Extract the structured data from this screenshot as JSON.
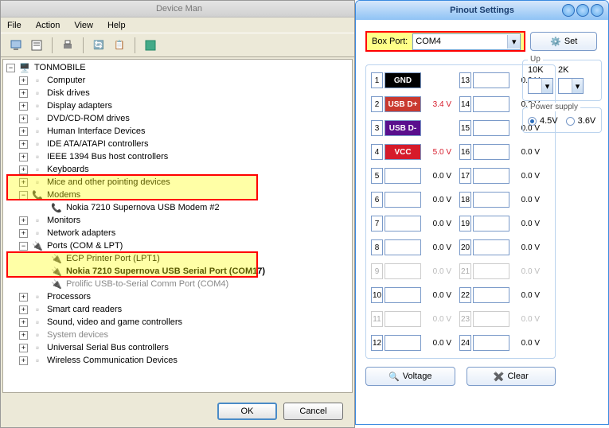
{
  "dm": {
    "title": "Device Man",
    "menu": [
      "File",
      "Action",
      "View",
      "Help"
    ],
    "root": "TONMOBILE",
    "items": [
      {
        "label": "Computer"
      },
      {
        "label": "Disk drives"
      },
      {
        "label": "Display adapters"
      },
      {
        "label": "DVD/CD-ROM drives"
      },
      {
        "label": "Human Interface Devices"
      },
      {
        "label": "IDE ATA/ATAPI controllers"
      },
      {
        "label": "IEEE 1394 Bus host controllers"
      },
      {
        "label": "Keyboards"
      },
      {
        "label": "Mice and other pointing devices"
      }
    ],
    "modems_label": "Modems",
    "modem_child": "Nokia 7210 Supernova USB Modem #2",
    "items2": [
      {
        "label": "Monitors"
      },
      {
        "label": "Network adapters"
      }
    ],
    "ports_label": "Ports (COM & LPT)",
    "port_ecp": "ECP Printer Port (LPT1)",
    "port_nokia": "Nokia 7210 Supernova USB Serial Port (COM17)",
    "port_prolific": "Prolific USB-to-Serial Comm Port (COM4)",
    "items3": [
      {
        "label": "Processors"
      },
      {
        "label": "Smart card readers"
      },
      {
        "label": "Sound, video and game controllers"
      },
      {
        "label": "System devices",
        "gray": true
      },
      {
        "label": "Universal Serial Bus controllers"
      },
      {
        "label": "Wireless Communication Devices"
      }
    ],
    "ok": "OK",
    "cancel": "Cancel"
  },
  "ps": {
    "title": "Pinout Settings",
    "box_port_label": "Box Port:",
    "box_port_value": "COM4",
    "set": "Set",
    "pins_left": [
      {
        "n": "1",
        "tag": "GND",
        "tagcls": "gnd",
        "val": ""
      },
      {
        "n": "2",
        "tag": "USB D+",
        "tagcls": "usbdp",
        "val": "3.4 V",
        "valcls": "red"
      },
      {
        "n": "3",
        "tag": "USB D-",
        "tagcls": "usbdm",
        "val": ""
      },
      {
        "n": "4",
        "tag": "VCC",
        "tagcls": "vcc",
        "val": "5.0 V",
        "valcls": "red"
      },
      {
        "n": "5",
        "tag": "",
        "tagcls": "empty",
        "val": "0.0 V"
      },
      {
        "n": "6",
        "tag": "",
        "tagcls": "empty",
        "val": "0.0 V"
      },
      {
        "n": "7",
        "tag": "",
        "tagcls": "empty",
        "val": "0.0 V"
      },
      {
        "n": "8",
        "tag": "",
        "tagcls": "empty",
        "val": "0.0 V"
      },
      {
        "n": "9",
        "tag": "",
        "tagcls": "empty gray-border",
        "val": "0.0 V",
        "gray": true
      },
      {
        "n": "10",
        "tag": "",
        "tagcls": "empty",
        "val": "0.0 V"
      },
      {
        "n": "11",
        "tag": "",
        "tagcls": "empty gray-border",
        "val": "0.0 V",
        "gray": true
      },
      {
        "n": "12",
        "tag": "",
        "tagcls": "empty",
        "val": "0.0 V"
      }
    ],
    "pins_right": [
      {
        "n": "13",
        "tag": "",
        "tagcls": "empty",
        "val": "0.0 V"
      },
      {
        "n": "14",
        "tag": "",
        "tagcls": "empty",
        "val": "0.0 V"
      },
      {
        "n": "15",
        "tag": "",
        "tagcls": "empty",
        "val": "0.0 V"
      },
      {
        "n": "16",
        "tag": "",
        "tagcls": "empty",
        "val": "0.0 V"
      },
      {
        "n": "17",
        "tag": "",
        "tagcls": "empty",
        "val": "0.0 V"
      },
      {
        "n": "18",
        "tag": "",
        "tagcls": "empty",
        "val": "0.0 V"
      },
      {
        "n": "19",
        "tag": "",
        "tagcls": "empty",
        "val": "0.0 V"
      },
      {
        "n": "20",
        "tag": "",
        "tagcls": "empty",
        "val": "0.0 V"
      },
      {
        "n": "21",
        "tag": "",
        "tagcls": "empty gray-border",
        "val": "0.0 V",
        "gray": true
      },
      {
        "n": "22",
        "tag": "",
        "tagcls": "empty",
        "val": "0.0 V"
      },
      {
        "n": "23",
        "tag": "",
        "tagcls": "empty gray-border",
        "val": "0.0 V",
        "gray": true
      },
      {
        "n": "24",
        "tag": "",
        "tagcls": "empty",
        "val": "0.0 V"
      }
    ],
    "up_label": "Up",
    "up_10k": "10K",
    "up_2k": "2K",
    "power_label": "Power supply",
    "power_45": "4.5V",
    "power_36": "3.6V",
    "voltage": "Voltage",
    "clear": "Clear"
  }
}
